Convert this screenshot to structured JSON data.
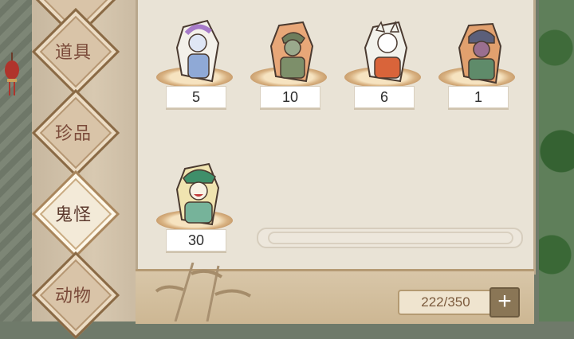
{
  "sidebar": {
    "tabs": [
      {
        "label": "道具",
        "active": false,
        "icon": "tab-diamond"
      },
      {
        "label": "珍品",
        "active": false,
        "icon": "tab-diamond"
      },
      {
        "label": "鬼怪",
        "active": true,
        "icon": "tab-diamond"
      },
      {
        "label": "动物",
        "active": false,
        "icon": "tab-diamond"
      }
    ]
  },
  "inventory": {
    "items": [
      {
        "count": "5",
        "icon": "ghost-lady-blue-icon",
        "color": "#8fa9d6"
      },
      {
        "count": "10",
        "icon": "ghost-jiangshi-icon",
        "color": "#7d8f6a"
      },
      {
        "count": "6",
        "icon": "ghost-cat-spirit-icon",
        "color": "#f2f2ec"
      },
      {
        "count": "1",
        "icon": "ghost-masked-warrior-icon",
        "color": "#9a6f8f"
      },
      {
        "count": "30",
        "icon": "ghost-green-hat-icon",
        "color": "#76b39a"
      }
    ]
  },
  "footer": {
    "capacity": "222/350",
    "add_label": "+"
  },
  "colors": {
    "panel": "#e9e3d6",
    "accent": "#8a7656",
    "tab_text": "#7b4b3a"
  }
}
